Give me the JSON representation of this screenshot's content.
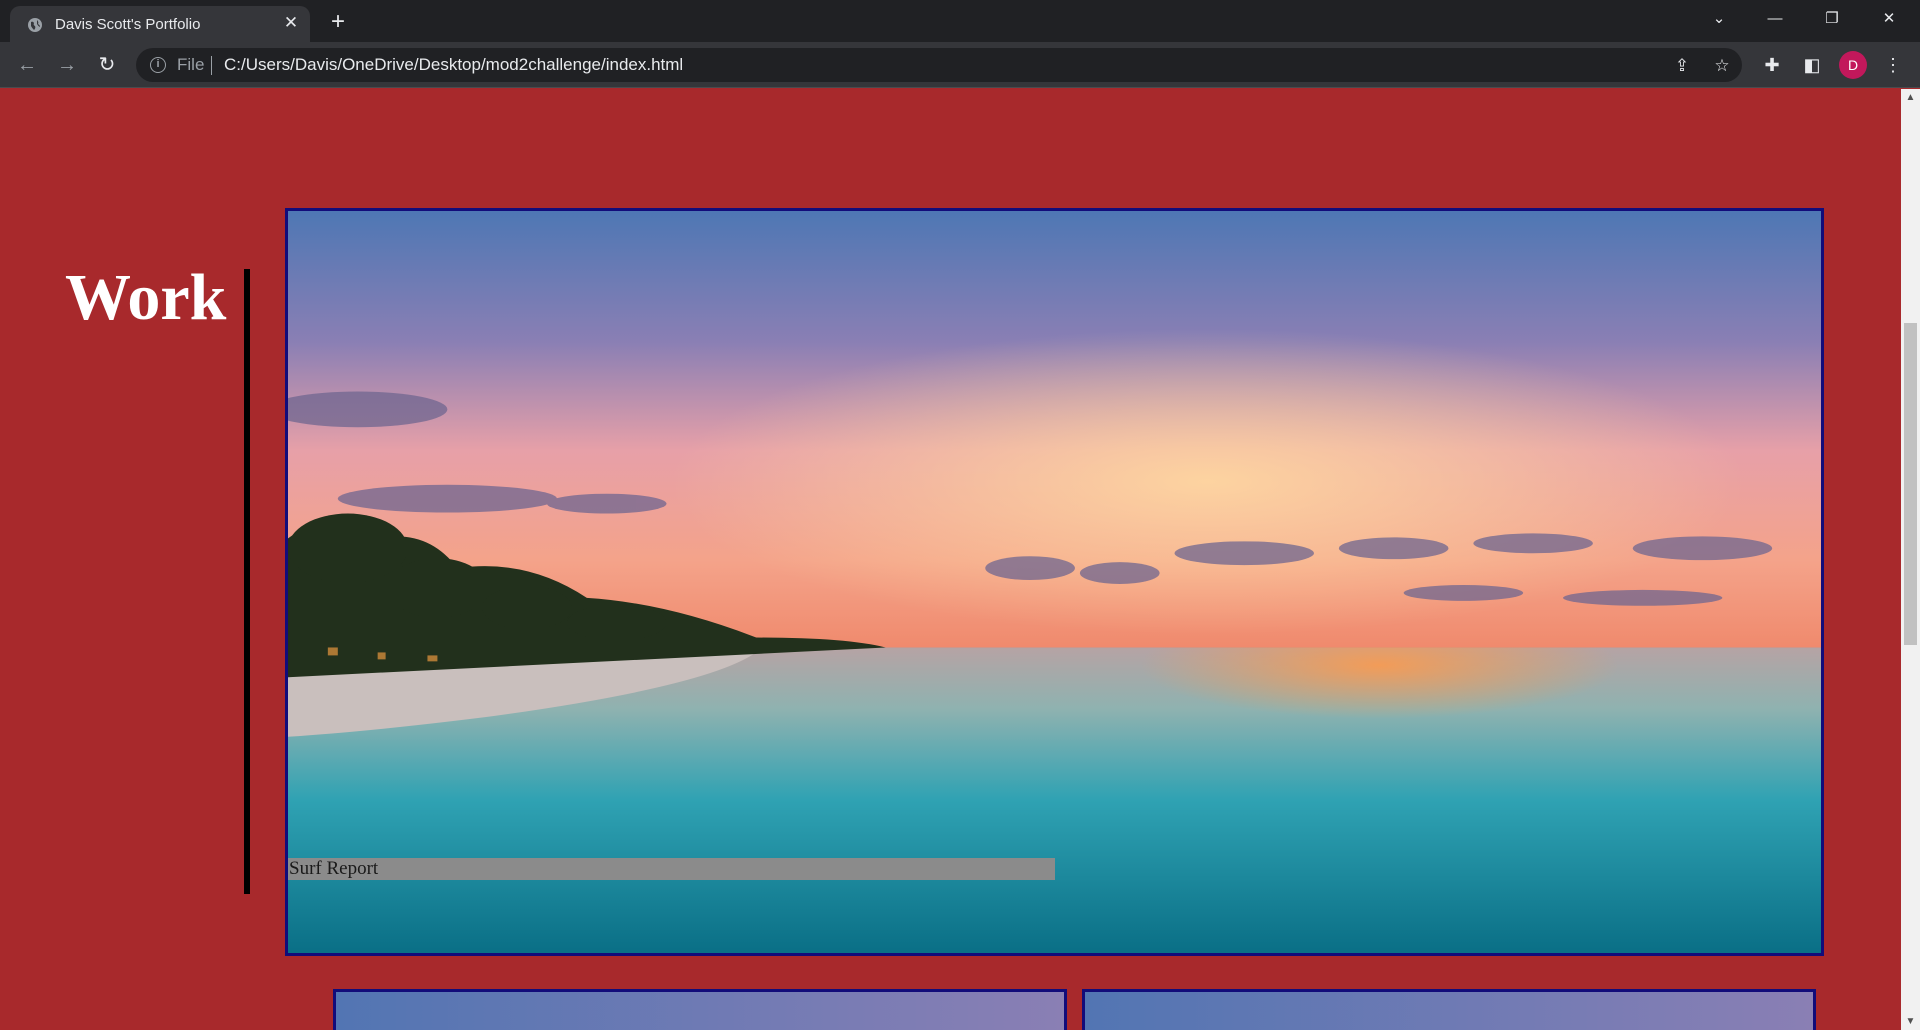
{
  "browser": {
    "tab": {
      "title": "Davis Scott's Portfolio",
      "favicon": "globe-icon",
      "close_icon": "close-icon"
    },
    "new_tab_icon": "plus-icon",
    "window_controls": [
      "chevron-down-icon",
      "minimize-icon",
      "restore-icon",
      "close-icon"
    ],
    "address_bar": {
      "scheme_label": "File",
      "url": "C:/Users/Davis/OneDrive/Desktop/mod2challenge/index.html"
    },
    "profile_initial": "D",
    "colors": {
      "frame": "#202124",
      "toolbar": "#35363a",
      "avatar": "#c2185b"
    }
  },
  "page": {
    "section_heading": "Work",
    "featured_project": {
      "caption": "Surf Report"
    },
    "colors": {
      "background": "#a8292c",
      "card_border": "#120c7a",
      "caption_background": "#8b8b8b",
      "rule": "#000000"
    }
  }
}
